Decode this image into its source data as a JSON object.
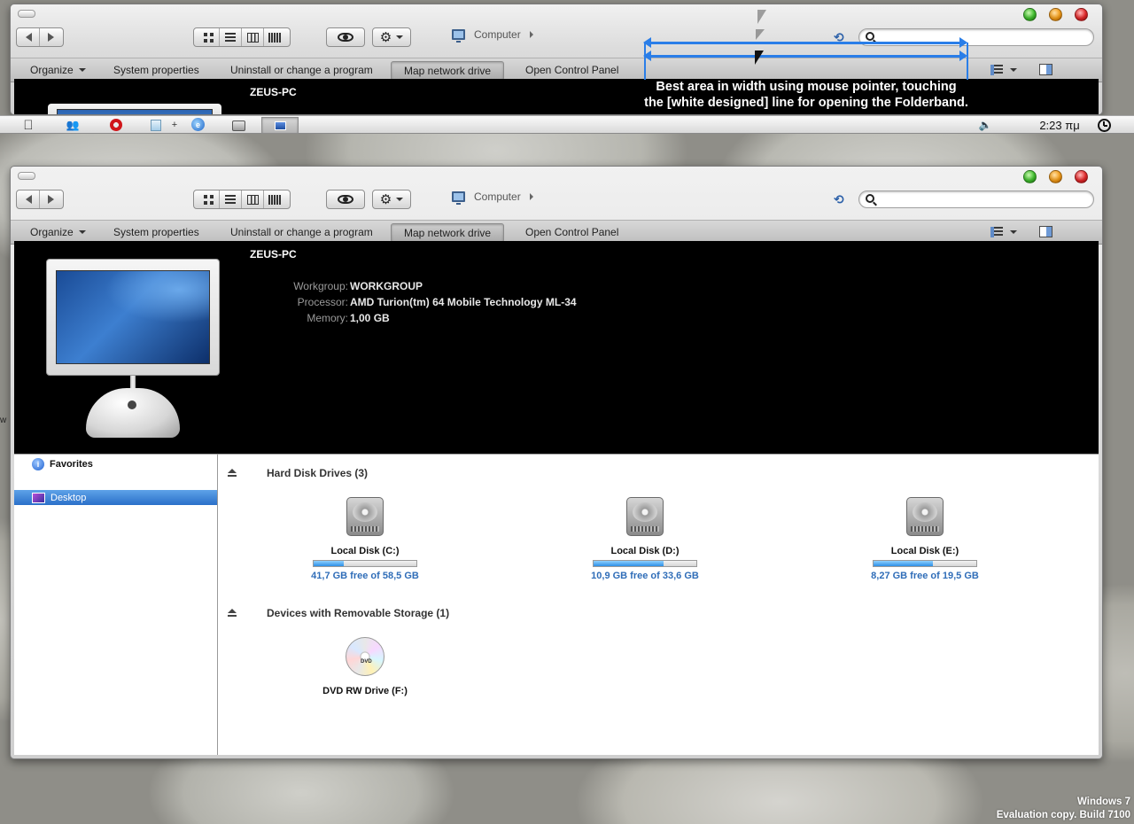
{
  "window": {
    "address": "Computer",
    "search_placeholder": "",
    "commands": {
      "organize": "Organize",
      "system_properties": "System properties",
      "uninstall": "Uninstall or change a program",
      "map_drive": "Map network drive",
      "control_panel": "Open Control Panel"
    }
  },
  "details": {
    "pc_name": "ZEUS-PC",
    "rows": [
      {
        "key": "Workgroup:",
        "value": "WORKGROUP"
      },
      {
        "key": "Processor:",
        "value": "AMD Turion(tm) 64 Mobile Technology ML-34"
      },
      {
        "key": "Memory:",
        "value": "1,00 GB"
      }
    ]
  },
  "sidebar": {
    "favorites": "Favorites",
    "desktop": "Desktop"
  },
  "groups": {
    "hdd_title": "Hard Disk Drives (3)",
    "removable_title": "Devices with Removable Storage (1)"
  },
  "drives": [
    {
      "name": "Local Disk (C:)",
      "free": "41,7 GB free of 58,5 GB",
      "used_fraction": 0.29
    },
    {
      "name": "Local Disk (D:)",
      "free": "10,9 GB free of 33,6 GB",
      "used_fraction": 0.68
    },
    {
      "name": "Local Disk (E:)",
      "free": "8,27 GB free of 19,5 GB",
      "used_fraction": 0.58
    }
  ],
  "removable": {
    "name": "DVD RW Drive (F:)",
    "disc_label": "DVD"
  },
  "annotation": {
    "line1": "Best area in width using mouse pointer, touching",
    "line2": "the [white designed] line  for opening the Folderband."
  },
  "taskbar": {
    "time": "2:23 πμ"
  },
  "watermark": {
    "line1": "Windows 7",
    "line2": "Evaluation copy. Build 7100"
  },
  "colors": {
    "accent_blue": "#2a7ee8",
    "selection": "#2a6fc9",
    "link_text": "#2f6db8",
    "band": "#000000"
  },
  "icons": [
    "back-icon",
    "forward-icon",
    "eye-icon",
    "gear-icon",
    "computer-icon",
    "refresh-icon",
    "search-icon",
    "favorites-icon",
    "desktop-icon",
    "hard-disk-icon",
    "dvd-icon",
    "apple-icon",
    "opera-icon",
    "speaker-icon",
    "clock-icon"
  ]
}
